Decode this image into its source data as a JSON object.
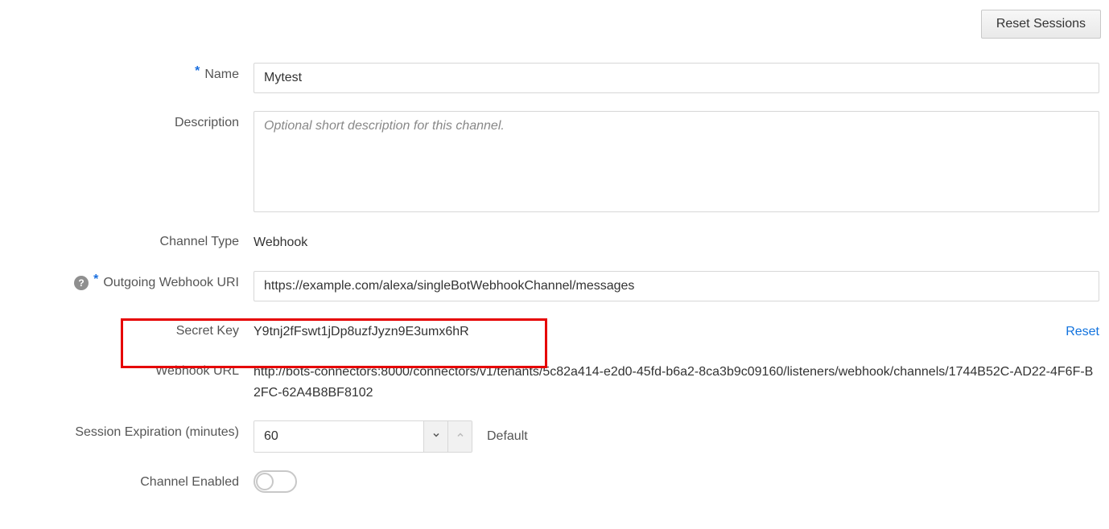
{
  "topbar": {
    "reset_sessions": "Reset Sessions"
  },
  "fields": {
    "name": {
      "label": "Name",
      "value": "Mytest",
      "required": true
    },
    "description": {
      "label": "Description",
      "placeholder": "Optional short description for this channel.",
      "value": ""
    },
    "channel_type": {
      "label": "Channel Type",
      "value": "Webhook"
    },
    "outgoing_uri": {
      "label": "Outgoing Webhook URI",
      "value": "https://example.com/alexa/singleBotWebhookChannel/messages",
      "required": true,
      "help": "?"
    },
    "secret_key": {
      "label": "Secret Key",
      "value": "Y9tnj2fFswt1jDp8uzfJyzn9E3umx6hR",
      "reset_label": "Reset"
    },
    "webhook_url": {
      "label": "Webhook URL",
      "value": "http://bots-connectors:8000/connectors/v1/tenants/5c82a414-e2d0-45fd-b6a2-8ca3b9c09160/listeners/webhook/channels/1744B52C-AD22-4F6F-B2FC-62A4B8BF8102"
    },
    "session_exp": {
      "label": "Session Expiration (minutes)",
      "value": "60",
      "default_label": "Default"
    },
    "channel_enabled": {
      "label": "Channel Enabled",
      "value": false
    }
  }
}
